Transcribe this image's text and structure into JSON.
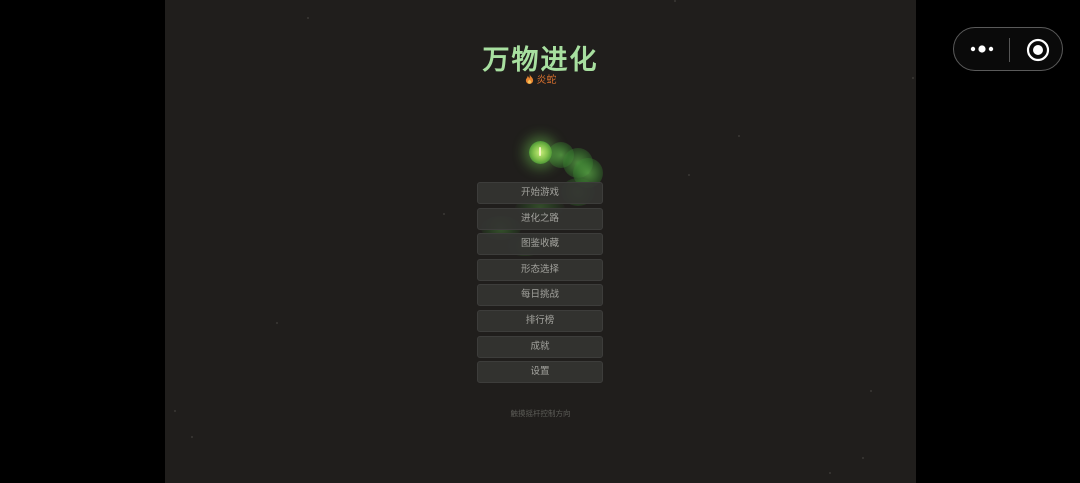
{
  "title": "万物进化",
  "subtitle": "炎蛇",
  "menu": {
    "items": [
      {
        "label": "开始游戏"
      },
      {
        "label": "进化之路"
      },
      {
        "label": "图鉴收藏"
      },
      {
        "label": "形态选择"
      },
      {
        "label": "每日挑战"
      },
      {
        "label": "排行榜"
      },
      {
        "label": "成就"
      },
      {
        "label": "设置"
      }
    ]
  },
  "hint": "触摸摇杆控制方向",
  "capsule": {
    "more_icon": "more-dots-icon",
    "close_icon": "target-close-icon"
  },
  "colors": {
    "background": "#201e1c",
    "title": "#a8e0a0",
    "subtitle": "#d9702e",
    "snake": "#5aa846"
  }
}
